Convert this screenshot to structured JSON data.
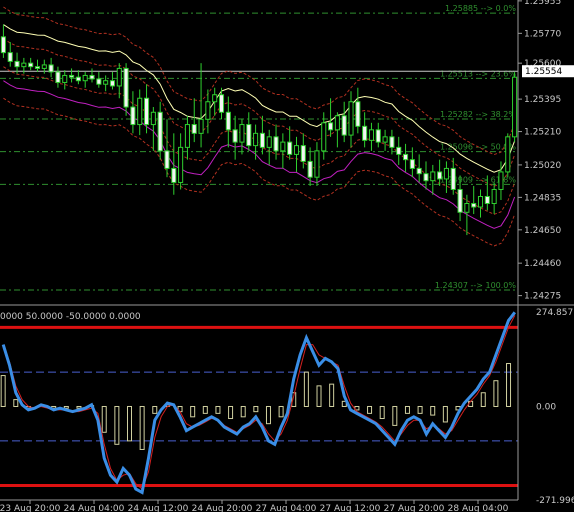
{
  "chart_data": [
    {
      "type": "candlestick",
      "panel": "price",
      "ylim": [
        1.2425,
        1.2596
      ],
      "y_ticks": [
        "1.25955",
        "1.25770",
        "1.25600",
        "1.25395",
        "1.25210",
        "1.25020",
        "1.24835",
        "1.24650",
        "1.24460",
        "1.24275"
      ],
      "last_price_label": "1.25554",
      "last_price": 1.25554,
      "fib_levels": [
        {
          "label": "1.25885 --> 0.0%",
          "price": 1.25885
        },
        {
          "label": "1.25513 --> 23.6%",
          "price": 1.25513
        },
        {
          "label": "1.25282 --> 38.2%",
          "price": 1.25282
        },
        {
          "label": "1.25096 --> 50.0%",
          "price": 1.25096
        },
        {
          "label": "1.24909 --> 61.8%",
          "price": 1.24909
        },
        {
          "label": "1.24307 --> 100.0%",
          "price": 1.24307
        }
      ],
      "candles": [
        [
          1.2575,
          1.2582,
          1.2563,
          1.2566
        ],
        [
          1.2566,
          1.2572,
          1.2558,
          1.2561
        ],
        [
          1.2561,
          1.2566,
          1.2554,
          1.2558
        ],
        [
          1.2558,
          1.2563,
          1.2554,
          1.256
        ],
        [
          1.256,
          1.2563,
          1.2556,
          1.2558
        ],
        [
          1.2558,
          1.2562,
          1.2555,
          1.2557
        ],
        [
          1.2557,
          1.2562,
          1.2554,
          1.2559
        ],
        [
          1.2559,
          1.2563,
          1.2552,
          1.2555
        ],
        [
          1.2555,
          1.2558,
          1.2546,
          1.2549
        ],
        [
          1.2549,
          1.2556,
          1.2545,
          1.2553
        ],
        [
          1.2553,
          1.2557,
          1.2549,
          1.2552
        ],
        [
          1.2552,
          1.2556,
          1.2548,
          1.255
        ],
        [
          1.255,
          1.2555,
          1.2546,
          1.2553
        ],
        [
          1.2553,
          1.2557,
          1.2549,
          1.2551
        ],
        [
          1.2551,
          1.2555,
          1.2546,
          1.2548
        ],
        [
          1.2548,
          1.2553,
          1.2544,
          1.255
        ],
        [
          1.255,
          1.2555,
          1.2545,
          1.2547
        ],
        [
          1.2547,
          1.256,
          1.254,
          1.2557
        ],
        [
          1.2557,
          1.256,
          1.253,
          1.2535
        ],
        [
          1.2535,
          1.2544,
          1.252,
          1.2525
        ],
        [
          1.2525,
          1.2545,
          1.2519,
          1.254
        ],
        [
          1.254,
          1.2548,
          1.252,
          1.2525
        ],
        [
          1.2525,
          1.2535,
          1.251,
          1.2532
        ],
        [
          1.2532,
          1.2538,
          1.2505,
          1.251
        ],
        [
          1.251,
          1.2528,
          1.2495,
          1.25
        ],
        [
          1.25,
          1.252,
          1.2485,
          1.2492
        ],
        [
          1.2492,
          1.252,
          1.2488,
          1.2512
        ],
        [
          1.2512,
          1.253,
          1.2505,
          1.2525
        ],
        [
          1.2525,
          1.254,
          1.2515,
          1.252
        ],
        [
          1.252,
          1.256,
          1.2512,
          1.2528
        ],
        [
          1.2528,
          1.2545,
          1.252,
          1.2538
        ],
        [
          1.2538,
          1.2546,
          1.253,
          1.2542
        ],
        [
          1.2542,
          1.2546,
          1.2528,
          1.2532
        ],
        [
          1.2532,
          1.2541,
          1.2512,
          1.2522
        ],
        [
          1.2522,
          1.253,
          1.2505,
          1.2515
        ],
        [
          1.2515,
          1.2528,
          1.2508,
          1.2525
        ],
        [
          1.2525,
          1.2532,
          1.251,
          1.2513
        ],
        [
          1.2513,
          1.2525,
          1.2505,
          1.252
        ],
        [
          1.252,
          1.253,
          1.2508,
          1.2512
        ],
        [
          1.2512,
          1.2522,
          1.2502,
          1.2518
        ],
        [
          1.2518,
          1.2525,
          1.2505,
          1.251
        ],
        [
          1.251,
          1.252,
          1.25,
          1.2515
        ],
        [
          1.2515,
          1.2524,
          1.2505,
          1.2508
        ],
        [
          1.2508,
          1.2518,
          1.2498,
          1.2513
        ],
        [
          1.2513,
          1.252,
          1.25,
          1.2504
        ],
        [
          1.2504,
          1.2512,
          1.249,
          1.2495
        ],
        [
          1.2495,
          1.2515,
          1.249,
          1.251
        ],
        [
          1.251,
          1.2532,
          1.2505,
          1.2526
        ],
        [
          1.2526,
          1.254,
          1.2518,
          1.2522
        ],
        [
          1.2522,
          1.2532,
          1.2512,
          1.253
        ],
        [
          1.253,
          1.2538,
          1.2515,
          1.2519
        ],
        [
          1.2519,
          1.2544,
          1.2512,
          1.2538
        ],
        [
          1.2538,
          1.2546,
          1.252,
          1.2524
        ],
        [
          1.2524,
          1.2532,
          1.2512,
          1.2516
        ],
        [
          1.2516,
          1.2526,
          1.251,
          1.2522
        ],
        [
          1.2522,
          1.2526,
          1.2512,
          1.2515
        ],
        [
          1.2515,
          1.2522,
          1.251,
          1.2518
        ],
        [
          1.2518,
          1.2522,
          1.2508,
          1.2512
        ],
        [
          1.2512,
          1.2518,
          1.2502,
          1.2508
        ],
        [
          1.2508,
          1.2514,
          1.2498,
          1.2505
        ],
        [
          1.2505,
          1.2512,
          1.2495,
          1.25
        ],
        [
          1.25,
          1.2508,
          1.2492,
          1.2497
        ],
        [
          1.2497,
          1.2504,
          1.2488,
          1.2493
        ],
        [
          1.2493,
          1.2502,
          1.2485,
          1.2498
        ],
        [
          1.2498,
          1.2505,
          1.249,
          1.2494
        ],
        [
          1.2494,
          1.2504,
          1.2486,
          1.25
        ],
        [
          1.25,
          1.2506,
          1.2485,
          1.2488
        ],
        [
          1.2488,
          1.2496,
          1.247,
          1.2475
        ],
        [
          1.2475,
          1.2485,
          1.2462,
          1.248
        ],
        [
          1.248,
          1.249,
          1.2474,
          1.2478
        ],
        [
          1.2478,
          1.2488,
          1.2472,
          1.2484
        ],
        [
          1.2484,
          1.2496,
          1.2476,
          1.248
        ],
        [
          1.248,
          1.2492,
          1.2474,
          1.2488
        ],
        [
          1.2488,
          1.2504,
          1.2482,
          1.2498
        ],
        [
          1.2498,
          1.252,
          1.2495,
          1.2518
        ],
        [
          1.2518,
          1.2555,
          1.2515,
          1.2552
        ]
      ],
      "upper_band_color": "#ffffb4",
      "lower_band_color": "#c020c0",
      "dotted_band_color": "#b03020"
    },
    {
      "type": "line",
      "panel": "oscillator",
      "header": "0000 50.0000 -50.0000 0.0000",
      "ylim": [
        -271.996,
        274.857
      ],
      "y_ticks": [
        "274.857",
        "0.00",
        "-271.996"
      ],
      "x_ticks": [
        "23 Aug 20:00",
        "24 Aug 04:00",
        "24 Aug 12:00",
        "24 Aug 20:00",
        "27 Aug 04:00",
        "27 Aug 12:00",
        "27 Aug 20:00",
        "28 Aug 04:00"
      ],
      "hlines": [
        {
          "value": 230,
          "color": "#dd1111"
        },
        {
          "value": 100,
          "color": "#4a5fd0"
        },
        {
          "value": -100,
          "color": "#4a5fd0"
        },
        {
          "value": -230,
          "color": "#dd1111"
        }
      ],
      "series": [
        {
          "color": "#3a8ee6",
          "values": [
            180,
            120,
            40,
            5,
            -10,
            -5,
            5,
            0,
            -10,
            -5,
            -10,
            -15,
            -10,
            -5,
            5,
            -40,
            -150,
            -200,
            -220,
            -180,
            -200,
            -240,
            -250,
            -150,
            -40,
            -10,
            10,
            5,
            -30,
            -70,
            -60,
            -50,
            -40,
            -30,
            -40,
            -60,
            -70,
            -80,
            -60,
            -50,
            -30,
            -60,
            -100,
            -110,
            -60,
            -20,
            80,
            150,
            200,
            160,
            120,
            140,
            130,
            110,
            30,
            -10,
            -20,
            -30,
            -40,
            -50,
            -70,
            -90,
            -110,
            -70,
            -40,
            -30,
            -40,
            -80,
            -50,
            -70,
            -90,
            -60,
            -20,
            10,
            30,
            50,
            80,
            100,
            150,
            200,
            250,
            274
          ]
        },
        {
          "color": "#d42020",
          "values": [
            170,
            130,
            60,
            20,
            0,
            -5,
            0,
            -5,
            -10,
            -10,
            -10,
            -15,
            -15,
            -10,
            -5,
            -20,
            -110,
            -180,
            -215,
            -200,
            -195,
            -225,
            -240,
            -190,
            -90,
            -30,
            0,
            5,
            -15,
            -50,
            -60,
            -55,
            -45,
            -35,
            -38,
            -55,
            -65,
            -75,
            -65,
            -55,
            -40,
            -50,
            -80,
            -100,
            -80,
            -40,
            30,
            110,
            180,
            180,
            150,
            140,
            130,
            120,
            60,
            10,
            -15,
            -25,
            -35,
            -45,
            -60,
            -80,
            -100,
            -80,
            -55,
            -40,
            -40,
            -65,
            -55,
            -65,
            -80,
            -70,
            -40,
            -10,
            15,
            35,
            65,
            90,
            130,
            180,
            230,
            265
          ]
        }
      ]
    }
  ]
}
